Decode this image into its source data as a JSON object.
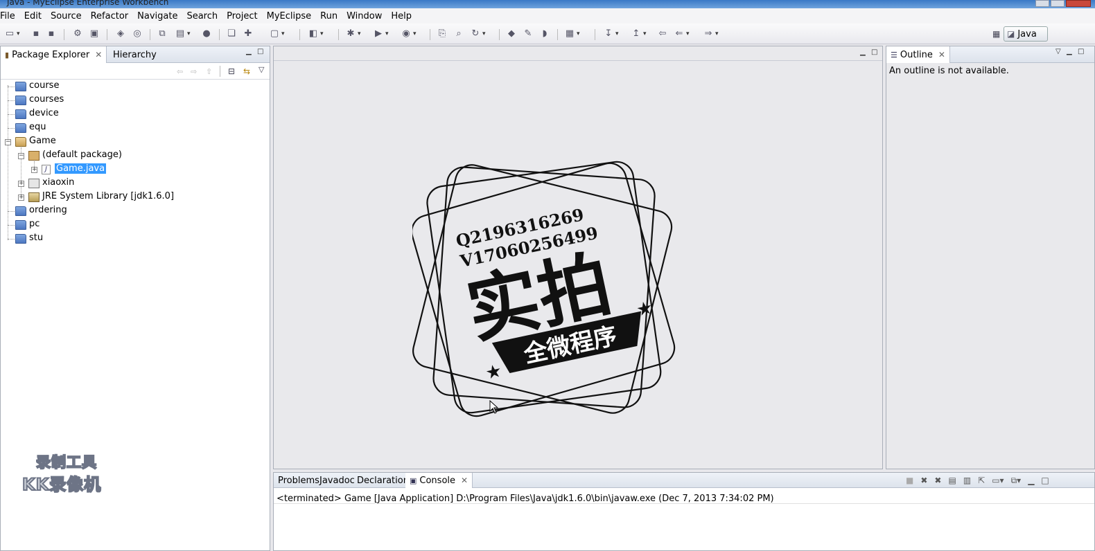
{
  "window": {
    "title": "Java - MyEclipse Enterprise Workbench"
  },
  "menu": [
    "File",
    "Edit",
    "Source",
    "Refactor",
    "Navigate",
    "Search",
    "Project",
    "MyEclipse",
    "Run",
    "Window",
    "Help"
  ],
  "perspective": {
    "label": "Java"
  },
  "package_explorer": {
    "tabs": [
      "Package Explorer",
      "Hierarchy"
    ],
    "items": [
      {
        "label": "course"
      },
      {
        "label": "courses"
      },
      {
        "label": "device"
      },
      {
        "label": "equ"
      },
      {
        "label": "Game",
        "expanded": true
      },
      {
        "label": "(default package)",
        "expanded": true
      },
      {
        "label": "Game.java",
        "selected": true
      },
      {
        "label": "xiaoxin"
      },
      {
        "label": "JRE System Library [jdk1.6.0]"
      },
      {
        "label": "ordering"
      },
      {
        "label": "pc"
      },
      {
        "label": "stu"
      }
    ]
  },
  "outline": {
    "tab": "Outline",
    "message": "An outline is not available."
  },
  "bottom": {
    "tabs": [
      "Problems",
      "Javadoc",
      "Declaration",
      "Console"
    ],
    "active_tab": "Console",
    "console_line": "<terminated> Game [Java Application] D:\\Program Files\\Java\\jdk1.6.0\\bin\\javaw.exe (Dec 7, 2013 7:34:02 PM)"
  },
  "stamp": {
    "line1": "Q219631626‪9",
    "line2": "V1706025649‪9",
    "big": "实拍",
    "banner": "全微程序"
  },
  "watermark": {
    "line1": "录制工具",
    "line2": "KK录像机"
  },
  "colors": {
    "selection": "#3399ff",
    "titlebar": "#3a79c6"
  }
}
